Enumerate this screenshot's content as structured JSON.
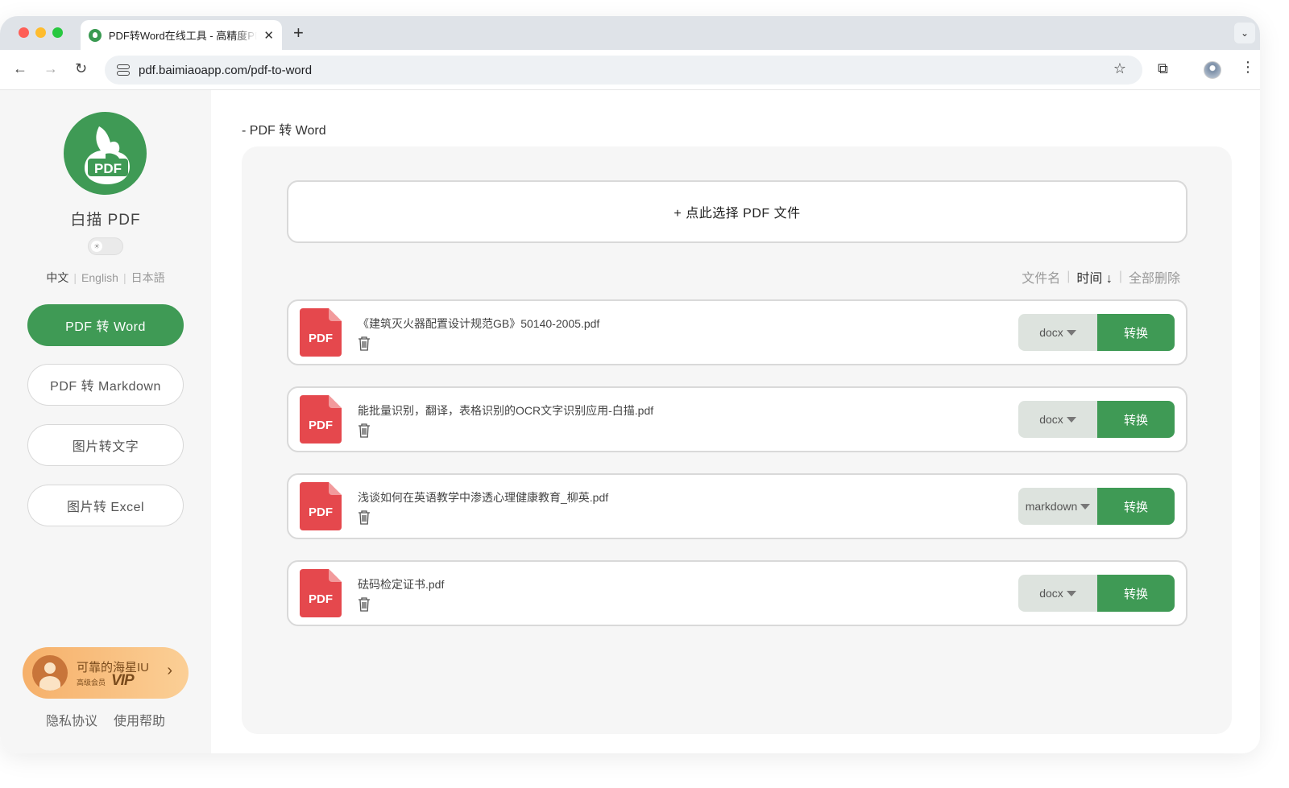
{
  "browser": {
    "tab_title": "PDF转Word在线工具 - 高精度PDF转Word",
    "tab_close": "✕",
    "new_tab": "+",
    "tab_menu": "⌄",
    "url": "pdf.baimiaoapp.com/pdf-to-word",
    "back": "←",
    "forward": "→",
    "reload": "↻",
    "star": "☆",
    "extensions": "⧉",
    "menu": "⋮"
  },
  "sidebar": {
    "logo_text": "PDF",
    "brand": "白描 PDF",
    "theme_icon": "☀",
    "languages": [
      "中文",
      "English",
      "日本語"
    ],
    "nav": [
      {
        "label": "PDF 转 Word",
        "active": true
      },
      {
        "label": "PDF 转 Markdown",
        "active": false
      },
      {
        "label": "图片转文字",
        "active": false
      },
      {
        "label": "图片转 Excel",
        "active": false
      }
    ],
    "user": {
      "name": "可靠的海星IU",
      "level": "高级会员",
      "badge": "VIP",
      "chevron": "›"
    },
    "footer": [
      "隐私协议",
      "使用帮助"
    ]
  },
  "main": {
    "breadcrumb": "- PDF 转 Word",
    "upload_label": "+ 点此选择 PDF 文件",
    "sort": {
      "by_name": "文件名",
      "by_time": "时间 ↓",
      "delete_all": "全部删除"
    },
    "pdf_icon_label": "PDF",
    "convert_label": "转换",
    "files": [
      {
        "name": "《建筑灭火器配置设计规范GB》50140-2005.pdf",
        "format": "docx"
      },
      {
        "name": "能批量识别，翻译，表格识别的OCR文字识别应用-白描.pdf",
        "format": "docx"
      },
      {
        "name": "浅谈如何在英语教学中渗透心理健康教育_柳英.pdf",
        "format": "markdown"
      },
      {
        "name": "砝码检定证书.pdf",
        "format": "docx"
      }
    ]
  },
  "colors": {
    "brand_green": "#3f9a55",
    "pdf_red": "#e5484d",
    "select_bg": "#dde3de"
  }
}
